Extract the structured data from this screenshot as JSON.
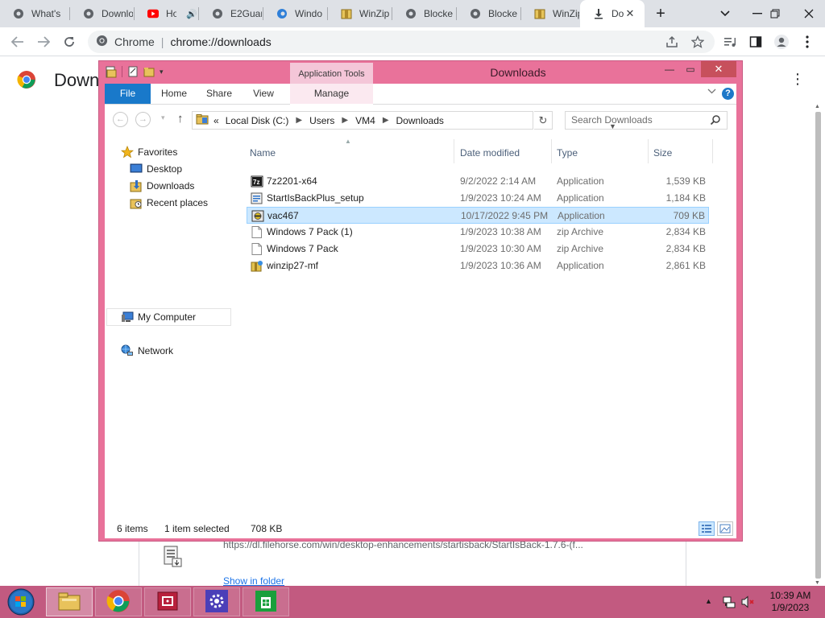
{
  "browser": {
    "tabs": [
      {
        "label": "What's",
        "icon": "globe-icon"
      },
      {
        "label": "Downlo",
        "icon": "globe-icon"
      },
      {
        "label": "Ho",
        "icon": "youtube-icon"
      },
      {
        "label": "E2Guar",
        "icon": "globe-icon"
      },
      {
        "label": "Windo",
        "icon": "edge-icon"
      },
      {
        "label": "WinZip",
        "icon": "winzip-icon"
      },
      {
        "label": "Blocke",
        "icon": "globe-icon"
      },
      {
        "label": "Blocke",
        "icon": "globe-icon"
      },
      {
        "label": "WinZip",
        "icon": "winzip-icon"
      },
      {
        "label": "Do",
        "icon": "download-icon"
      }
    ],
    "new_tab": "+",
    "omnibox": {
      "chip": "Chrome",
      "url": "chrome://downloads"
    }
  },
  "downloads_page": {
    "title": "Down",
    "item_url": "https://dl.filehorse.com/win/desktop-enhancements/startisback/StartIsBack-1.7.6-(f...",
    "show_in_folder": "Show in folder"
  },
  "explorer": {
    "title": "Downloads",
    "contextual_tab_group": "Application Tools",
    "ribbon_tabs": {
      "file": "File",
      "home": "Home",
      "share": "Share",
      "view": "View",
      "manage": "Manage"
    },
    "address": {
      "prefix": "«",
      "crumbs": [
        "Local Disk (C:)",
        "Users",
        "VM4",
        "Downloads"
      ]
    },
    "search_placeholder": "Search Downloads",
    "nav_pane": {
      "favorites": "Favorites",
      "desktop": "Desktop",
      "downloads": "Downloads",
      "recent": "Recent places",
      "computer": "My Computer",
      "network": "Network"
    },
    "columns": {
      "name": "Name",
      "date": "Date modified",
      "type": "Type",
      "size": "Size"
    },
    "files": [
      {
        "name": "7z2201-x64",
        "date": "9/2/2022 2:14 AM",
        "type": "Application",
        "size": "1,539 KB",
        "icon": "7zip-installer-icon",
        "selected": false
      },
      {
        "name": "StartIsBackPlus_setup",
        "date": "1/9/2023 10:24 AM",
        "type": "Application",
        "size": "1,184 KB",
        "icon": "installer-icon",
        "selected": false
      },
      {
        "name": "vac467",
        "date": "10/17/2022 9:45 PM",
        "type": "Application",
        "size": "709 KB",
        "icon": "exe-icon",
        "selected": true
      },
      {
        "name": "Windows 7 Pack (1)",
        "date": "1/9/2023 10:38 AM",
        "type": "zip Archive",
        "size": "2,834 KB",
        "icon": "zip-file-icon",
        "selected": false
      },
      {
        "name": "Windows 7 Pack",
        "date": "1/9/2023 10:30 AM",
        "type": "zip Archive",
        "size": "2,834 KB",
        "icon": "zip-file-icon",
        "selected": false
      },
      {
        "name": "winzip27-mf",
        "date": "1/9/2023 10:36 AM",
        "type": "Application",
        "size": "2,861 KB",
        "icon": "winzip-installer-icon",
        "selected": false
      }
    ],
    "status": {
      "items": "6 items",
      "selected": "1 item selected",
      "selected_size": "708 KB"
    }
  },
  "taskbar": {
    "clock_time": "10:39 AM",
    "clock_date": "1/9/2023"
  },
  "colors": {
    "window_frame": "#e9729a",
    "taskbar": "#c25a80",
    "selection": "#cce8ff",
    "file_tab": "#1979ca"
  }
}
